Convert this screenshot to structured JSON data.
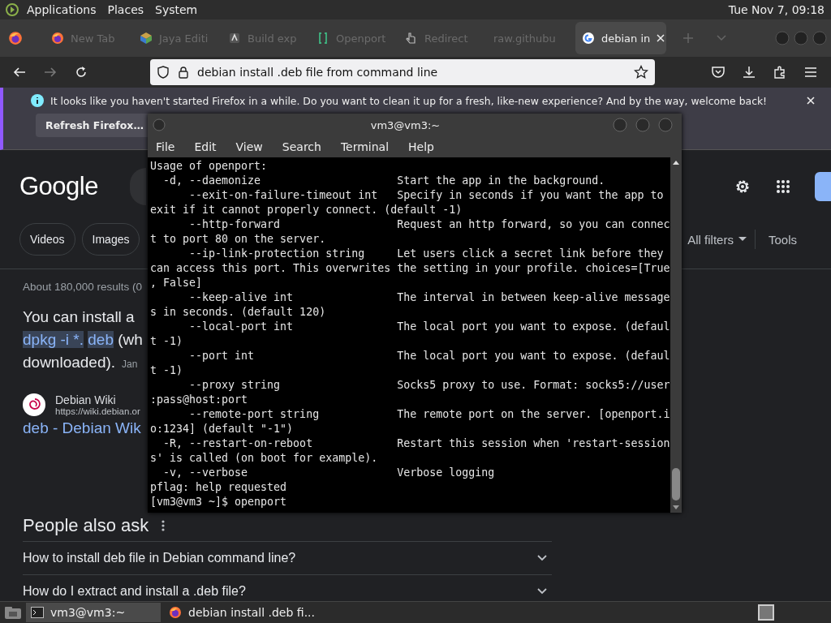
{
  "top_panel": {
    "menus": [
      "Applications",
      "Places",
      "System"
    ],
    "clock": "Tue Nov 7, 09:18"
  },
  "browser": {
    "tabs": [
      {
        "label": "New Tab",
        "kind": "firefox",
        "selected": false
      },
      {
        "label": "Jaya Editi",
        "kind": "cube",
        "selected": false
      },
      {
        "label": "Build exp",
        "kind": "app",
        "selected": false
      },
      {
        "label": "Openport",
        "kind": "bracket",
        "selected": false
      },
      {
        "label": "Redirect",
        "kind": "hand",
        "selected": false
      },
      {
        "label": "raw.githubu",
        "kind": "plain",
        "selected": false
      },
      {
        "label": "debian in",
        "kind": "google",
        "selected": true
      }
    ],
    "url": "debian install .deb file from command line",
    "notification": {
      "message": "It looks like you haven't started Firefox in a while. Do you want to clean it up for a fresh, like-new experience? And by the way, welcome back!",
      "button": "Refresh Firefox…"
    },
    "page": {
      "logo": "Google",
      "chips": [
        "Videos",
        "Images"
      ],
      "filters": "All filters",
      "tools": "Tools",
      "stats": "About 180,000 results (0",
      "answer": {
        "lines": [
          [
            {
              "text": "You can install a",
              "highlighted": false
            }
          ],
          [
            {
              "text": "dpkg -i *.",
              "highlighted": true
            },
            {
              "text": "deb",
              "highlighted": true
            },
            {
              "text": "(wh",
              "highlighted": false
            }
          ],
          [
            {
              "text": "downloaded).",
              "highlighted": false
            }
          ]
        ],
        "date": "Jan"
      },
      "source": {
        "name": "Debian Wiki",
        "url": "https://wiki.debian.or",
        "title": "deb - Debian Wik"
      },
      "people_also_ask": {
        "heading": "People also ask",
        "questions": [
          "How to install deb file in Debian command line?",
          "How do I extract and install a .deb file?"
        ]
      }
    }
  },
  "terminal": {
    "title": "vm3@vm3:~",
    "menus": [
      "File",
      "Edit",
      "View",
      "Search",
      "Terminal",
      "Help"
    ],
    "lines": [
      "Usage of openport:",
      "  -d, --daemonize                     Start the app in the background.",
      "      --exit-on-failure-timeout int   Specify in seconds if you want the app to",
      "exit if it cannot properly connect. (default -1)",
      "      --http-forward                  Request an http forward, so you can connec",
      "t to port 80 on the server.",
      "      --ip-link-protection string     Let users click a secret link before they",
      "can access this port. This overwrites the setting in your profile. choices=[True",
      ", False]",
      "      --keep-alive int                The interval in between keep-alive message",
      "s in seconds. (default 120)",
      "      --local-port int                The local port you want to expose. (defaul",
      "t -1)",
      "      --port int                      The local port you want to expose. (defaul",
      "t -1)",
      "      --proxy string                  Socks5 proxy to use. Format: socks5://user",
      ":pass@host:port",
      "      --remote-port string            The remote port on the server. [openport.i",
      "o:1234] (default \"-1\")",
      "  -R, --restart-on-reboot             Restart this session when 'restart-session",
      "s' is called (on boot for example).",
      "  -v, --verbose                       Verbose logging",
      "pflag: help requested",
      "[vm3@vm3 ~]$ openport"
    ]
  },
  "taskbar": {
    "tasks": [
      {
        "label": "vm3@vm3:~",
        "kind": "terminal",
        "selected": true
      },
      {
        "label": "debian install .deb fi...",
        "kind": "firefox",
        "selected": false
      }
    ]
  }
}
